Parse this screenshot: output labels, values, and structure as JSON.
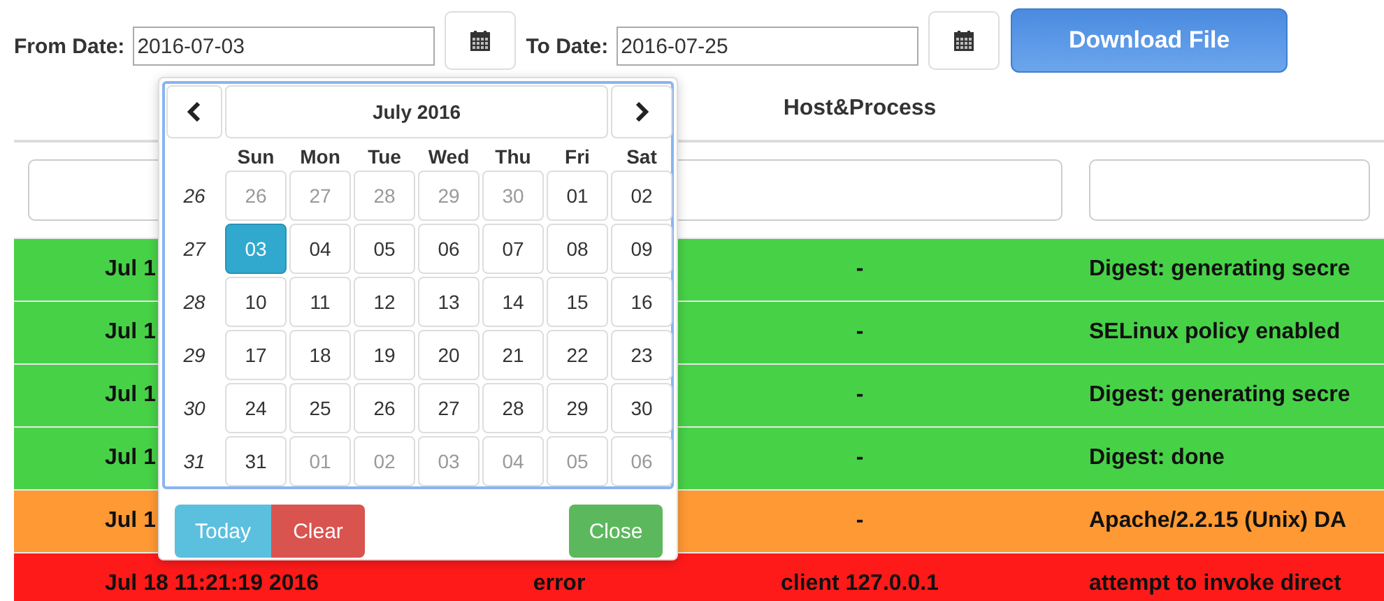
{
  "toolbar": {
    "from_label": "From Date:",
    "from_value": "2016-07-03",
    "to_label": "To Date:",
    "to_value": "2016-07-25",
    "download_button": "Download File"
  },
  "table": {
    "host_column_title": "Host&Process",
    "rows": [
      {
        "color": "#47d147",
        "date": "Jul 1",
        "host": "-",
        "message": "Digest: generating secre"
      },
      {
        "color": "#47d147",
        "date": "Jul 1",
        "host": "-",
        "message": "SELinux policy enabled"
      },
      {
        "color": "#47d147",
        "date": "Jul 1",
        "host": "-",
        "message": "Digest: generating secre"
      },
      {
        "color": "#47d147",
        "date": "Jul 1",
        "host": "-",
        "message": "Digest: done"
      },
      {
        "color": "#ff9933",
        "date": "Jul 1",
        "host": "-",
        "message": "Apache/2.2.15 (Unix) DA"
      },
      {
        "color": "#ff1a1a",
        "date": "Jul 18 11:21:19 2016",
        "severity": "error",
        "host": "client 127.0.0.1",
        "message": "attempt to invoke direct"
      }
    ]
  },
  "datepicker": {
    "title": "July 2016",
    "weekdays": [
      "Sun",
      "Mon",
      "Tue",
      "Wed",
      "Thu",
      "Fri",
      "Sat"
    ],
    "weeks": [
      {
        "number": "26",
        "days": [
          {
            "label": "26",
            "muted": true,
            "selected": false
          },
          {
            "label": "27",
            "muted": true,
            "selected": false
          },
          {
            "label": "28",
            "muted": true,
            "selected": false
          },
          {
            "label": "29",
            "muted": true,
            "selected": false
          },
          {
            "label": "30",
            "muted": true,
            "selected": false
          },
          {
            "label": "01",
            "muted": false,
            "selected": false
          },
          {
            "label": "02",
            "muted": false,
            "selected": false
          }
        ]
      },
      {
        "number": "27",
        "days": [
          {
            "label": "03",
            "muted": false,
            "selected": true
          },
          {
            "label": "04",
            "muted": false,
            "selected": false
          },
          {
            "label": "05",
            "muted": false,
            "selected": false
          },
          {
            "label": "06",
            "muted": false,
            "selected": false
          },
          {
            "label": "07",
            "muted": false,
            "selected": false
          },
          {
            "label": "08",
            "muted": false,
            "selected": false
          },
          {
            "label": "09",
            "muted": false,
            "selected": false
          }
        ]
      },
      {
        "number": "28",
        "days": [
          {
            "label": "10",
            "muted": false,
            "selected": false
          },
          {
            "label": "11",
            "muted": false,
            "selected": false
          },
          {
            "label": "12",
            "muted": false,
            "selected": false
          },
          {
            "label": "13",
            "muted": false,
            "selected": false
          },
          {
            "label": "14",
            "muted": false,
            "selected": false
          },
          {
            "label": "15",
            "muted": false,
            "selected": false
          },
          {
            "label": "16",
            "muted": false,
            "selected": false
          }
        ]
      },
      {
        "number": "29",
        "days": [
          {
            "label": "17",
            "muted": false,
            "selected": false
          },
          {
            "label": "18",
            "muted": false,
            "selected": false
          },
          {
            "label": "19",
            "muted": false,
            "selected": false
          },
          {
            "label": "20",
            "muted": false,
            "selected": false
          },
          {
            "label": "21",
            "muted": false,
            "selected": false
          },
          {
            "label": "22",
            "muted": false,
            "selected": false
          },
          {
            "label": "23",
            "muted": false,
            "selected": false
          }
        ]
      },
      {
        "number": "30",
        "days": [
          {
            "label": "24",
            "muted": false,
            "selected": false
          },
          {
            "label": "25",
            "muted": false,
            "selected": false
          },
          {
            "label": "26",
            "muted": false,
            "selected": false
          },
          {
            "label": "27",
            "muted": false,
            "selected": false
          },
          {
            "label": "28",
            "muted": false,
            "selected": false
          },
          {
            "label": "29",
            "muted": false,
            "selected": false
          },
          {
            "label": "30",
            "muted": false,
            "selected": false
          }
        ]
      },
      {
        "number": "31",
        "days": [
          {
            "label": "31",
            "muted": false,
            "selected": false
          },
          {
            "label": "01",
            "muted": true,
            "selected": false
          },
          {
            "label": "02",
            "muted": true,
            "selected": false
          },
          {
            "label": "03",
            "muted": true,
            "selected": false
          },
          {
            "label": "04",
            "muted": true,
            "selected": false
          },
          {
            "label": "05",
            "muted": true,
            "selected": false
          },
          {
            "label": "06",
            "muted": true,
            "selected": false
          }
        ]
      }
    ],
    "buttons": [
      {
        "kind": "today",
        "label": "Today"
      },
      {
        "kind": "clear",
        "label": "Clear"
      },
      {
        "kind": "close",
        "label": "Close"
      }
    ]
  }
}
